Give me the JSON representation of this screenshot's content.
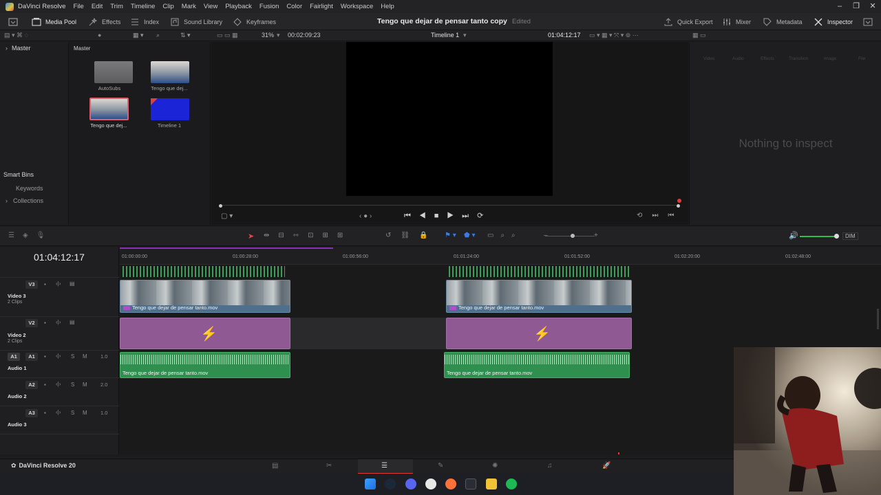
{
  "app": {
    "name": "DaVinci Resolve",
    "menu": [
      "File",
      "Edit",
      "Trim",
      "Timeline",
      "Clip",
      "Mark",
      "View",
      "Playback",
      "Fusion",
      "Color",
      "Fairlight",
      "Workspace",
      "Help"
    ]
  },
  "toolbar": {
    "media_pool": "Media Pool",
    "effects": "Effects",
    "index": "Index",
    "sound_library": "Sound Library",
    "keyframes": "Keyframes",
    "project_title": "Tengo que dejar de pensar tanto copy",
    "edited": "Edited",
    "quick_export": "Quick Export",
    "mixer": "Mixer",
    "metadata": "Metadata",
    "inspector": "Inspector"
  },
  "viewer_bar": {
    "zoom": "31%",
    "duration": "00:02:09:23",
    "timeline_name": "Timeline 1",
    "timecode": "01:04:12:17"
  },
  "bins": {
    "master": "Master",
    "smart_bins": "Smart Bins",
    "keywords": "Keywords",
    "collections": "Collections"
  },
  "media_pool": {
    "header": "Master",
    "items": [
      {
        "label": "AutoSubs",
        "kind": "folder"
      },
      {
        "label": "Tengo que dej...",
        "kind": "video"
      },
      {
        "label": "Tengo que dej...",
        "kind": "video"
      },
      {
        "label": "Timeline 1",
        "kind": "timeline"
      }
    ]
  },
  "inspector": {
    "tabs": [
      "Video",
      "Audio",
      "Effects",
      "Transition",
      "Image",
      "File"
    ],
    "empty": "Nothing to inspect"
  },
  "timeline": {
    "timecode": "01:04:12:17",
    "ruler": [
      "01:00:00:00",
      "01:00:28:00",
      "01:00:56:00",
      "01:01:24:00",
      "01:01:52:00",
      "01:02:20:00",
      "01:02:48:00"
    ],
    "dim": "DIM",
    "tracks": [
      {
        "id": "V3",
        "name": "Video 3",
        "sub": "2 Clips"
      },
      {
        "id": "V2",
        "name": "Video 2",
        "sub": "2 Clips"
      },
      {
        "id": "A1",
        "name": "Audio 1",
        "vol": "1.0",
        "solo": "S",
        "mute": "M"
      },
      {
        "id": "A2",
        "name": "Audio 2",
        "vol": "2.0",
        "solo": "S",
        "mute": "M"
      },
      {
        "id": "A3",
        "name": "Audio 3",
        "vol": "1.0",
        "solo": "S",
        "mute": "M"
      }
    ],
    "clip_name": "Tengo que dejar de pensar tanto.mov"
  },
  "pagebar": {
    "brand": "DaVinci Resolve 20"
  },
  "colors": {
    "video_clip": "#4f6f8a",
    "fusion_clip": "#8f5a94",
    "audio_clip": "#2f8f4f",
    "playhead": "#e53935",
    "accent": "#3a8ee6"
  }
}
